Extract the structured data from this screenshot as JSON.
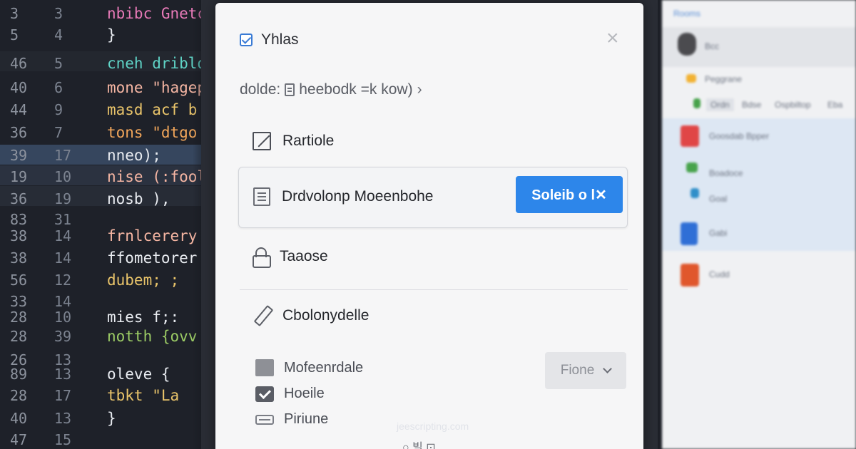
{
  "editor": {
    "lines": [
      {
        "n1": "3",
        "n2": "3",
        "code": "nbibc Gnetcg",
        "color": "pink"
      },
      {
        "n1": "5",
        "n2": "4",
        "code": "}",
        "color": "white"
      },
      {
        "n1": "46",
        "n2": "5",
        "code": "cneh dribloo",
        "color": "teal"
      },
      {
        "n1": "40",
        "n2": "6",
        "code": "mone \"hagep",
        "color": "peach"
      },
      {
        "n1": "44",
        "n2": "9",
        "code": "masd acf b",
        "color": "yellow"
      },
      {
        "n1": "36",
        "n2": "7",
        "code": "tons \"dtgo",
        "color": "orange"
      },
      {
        "n1": "39",
        "n2": "17",
        "code": "nneo);",
        "color": "white"
      },
      {
        "n1": "19",
        "n2": "10",
        "code": "nise (:fools",
        "color": "peach"
      },
      {
        "n1": "36",
        "n2": "19",
        "code": "nosb ),",
        "color": "white"
      },
      {
        "n1": "83",
        "n2": "31",
        "code": "",
        "color": "white"
      },
      {
        "n1": "38",
        "n2": "14",
        "code": "frnlcerery",
        "color": "peach"
      },
      {
        "n1": "38",
        "n2": "14",
        "code": "ffometorer",
        "color": "white"
      },
      {
        "n1": "56",
        "n2": "12",
        "code": "dubem;  ;",
        "color": "yellow"
      },
      {
        "n1": "33",
        "n2": "14",
        "code": "",
        "color": "white"
      },
      {
        "n1": "28",
        "n2": "10",
        "code": "mies f;:",
        "color": "white"
      },
      {
        "n1": "28",
        "n2": "39",
        "code": "notth  {ovv",
        "color": "green"
      },
      {
        "n1": "26",
        "n2": "13",
        "code": "",
        "color": "white"
      },
      {
        "n1": "89",
        "n2": "13",
        "code": "  oleve {",
        "color": "white"
      },
      {
        "n1": "28",
        "n2": "17",
        "code": "  tbkt \"La",
        "color": "yellow"
      },
      {
        "n1": "40",
        "n2": "13",
        "code": "}",
        "color": "white"
      },
      {
        "n1": "47",
        "n2": "15",
        "code": "",
        "color": "white"
      }
    ]
  },
  "dialog": {
    "title": "Yhlas",
    "close_label": "×",
    "breadcrumb": {
      "prefix": "dolde:",
      "path": "heebodk =k kow)",
      "chevron": "›"
    },
    "option_1": "Rartiole",
    "selected_option": "Drdvolonp  Moeenbohe",
    "primary_button": "Soleib o l✕",
    "option_2": "Taaose",
    "option_3": "Cbolonydelle",
    "checks": {
      "item_1": "Mofeenrdale",
      "item_2": "Hoeile",
      "item_3": "Piriune"
    },
    "dropdown_value": "Fione",
    "watermark": "jeescripting.com",
    "footer_glyphs": "○ 빌 ⊡"
  },
  "right_panel": {
    "header": "Rooms",
    "user": "Bcc",
    "folder": "Peggrane",
    "filters": [
      "Ordn",
      "Bdse",
      "Ospbiltop",
      "Eba"
    ],
    "items": [
      {
        "label": "Goosdab Bpper",
        "accent": "#e04646"
      },
      {
        "label": "Boadoce",
        "accent": "#47a34b"
      },
      {
        "label": "Goal",
        "accent": "#2f8fc9"
      },
      {
        "label": "Gabi",
        "accent": "#2f6fd6"
      },
      {
        "label": "Cudd",
        "accent": "#e0572c"
      }
    ]
  },
  "colors": {
    "accent": "#2d86ea",
    "editor_bg": "#1e2129",
    "dialog_bg": "#f6f6f7"
  }
}
